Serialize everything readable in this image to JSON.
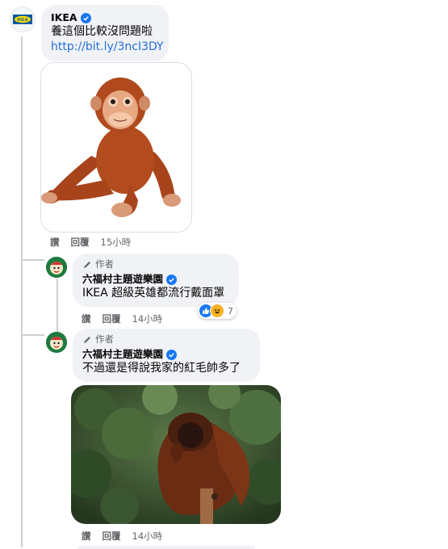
{
  "comment1": {
    "author": "IKEA",
    "text": "養這個比較沒問題啦",
    "link": "http://bit.ly/3ncI3DY",
    "actions": {
      "like": "讚",
      "reply": "回覆",
      "time": "15小時"
    }
  },
  "reply1": {
    "badge": "作者",
    "author": "六福村主題遊樂園",
    "text": "IKEA 超級英雄都流行戴面罩",
    "reaction_count": "7",
    "actions": {
      "like": "讚",
      "reply": "回覆",
      "time": "14小時"
    }
  },
  "reply2": {
    "badge": "作者",
    "author": "六福村主題遊樂園",
    "text": "不過還是得說我家的紅毛帥多了",
    "actions": {
      "like": "讚",
      "reply": "回覆",
      "time": "14小時"
    }
  },
  "colors": {
    "bubble": "#f0f2f5",
    "link": "#216fdb",
    "verified": "#1877f2",
    "meta": "#65676b"
  },
  "icons": [
    "ikea-logo",
    "verified-icon",
    "pencil-icon",
    "like-reaction-icon",
    "haha-reaction-icon",
    "leofoo-avatar"
  ]
}
